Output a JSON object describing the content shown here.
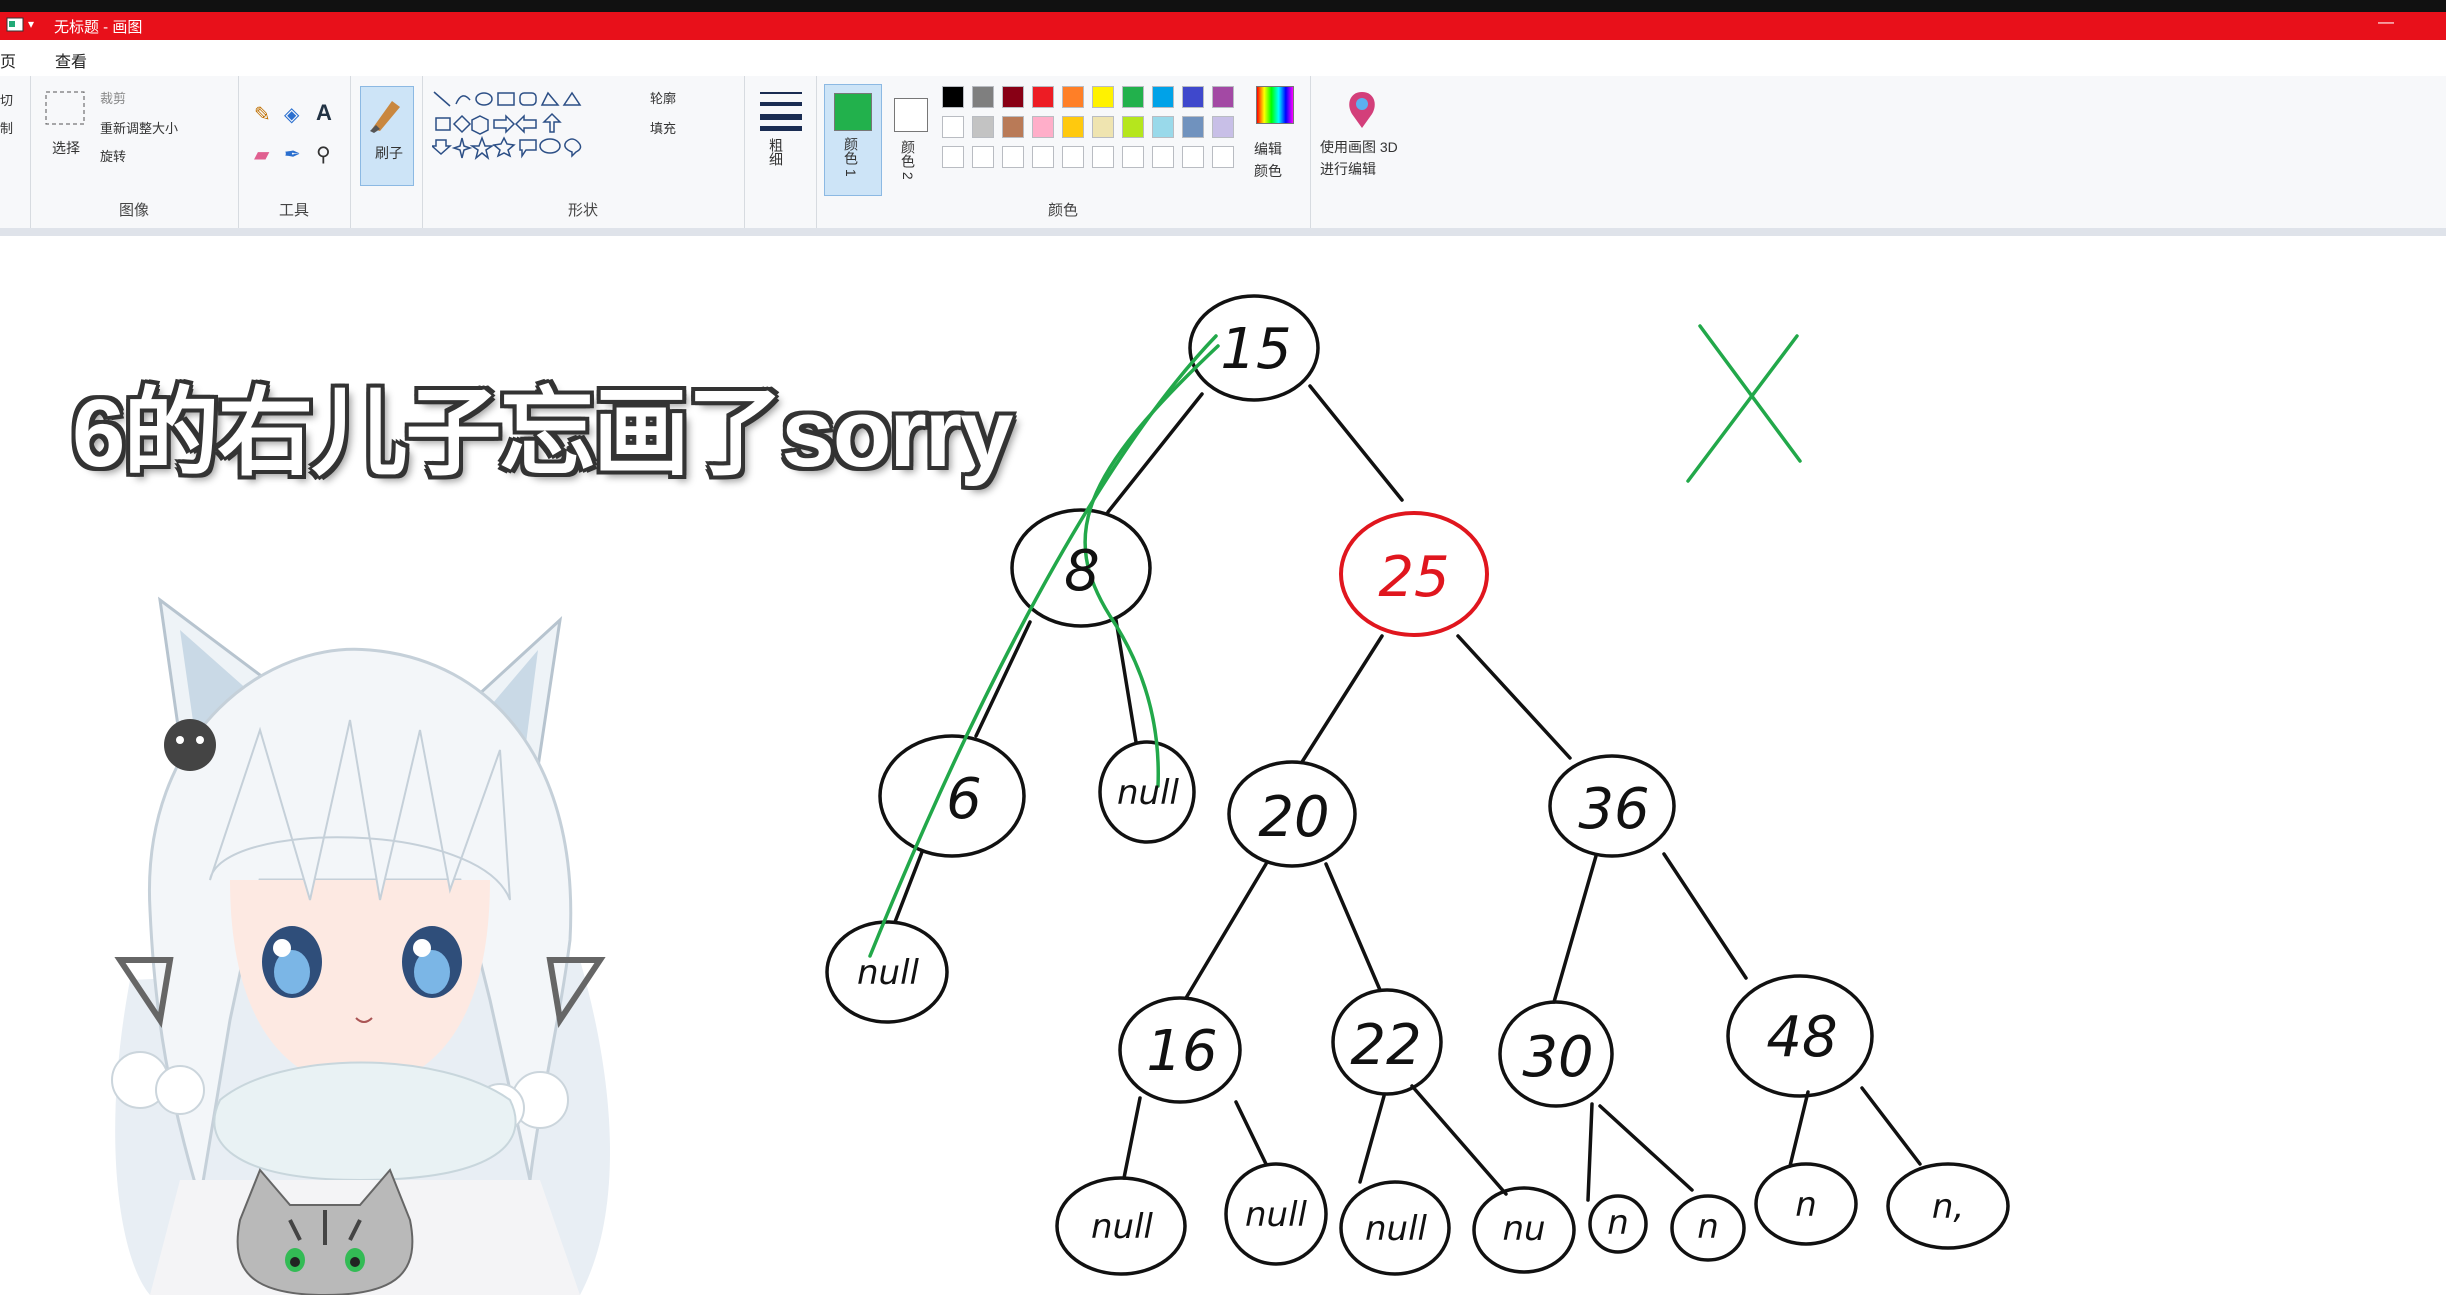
{
  "window": {
    "title": "无标题 - 画图"
  },
  "menu": {
    "home_tab": "页",
    "view_tab": "查看"
  },
  "ribbon": {
    "clip_cut": "切",
    "clip_copy": "制",
    "image_select": "选择",
    "image_crop": "裁剪",
    "image_resize": "重新调整大小",
    "image_rotate": "旋转",
    "image_group": "图像",
    "tools_group": "工具",
    "brush_label": "刷子",
    "shapes_outline": "轮廓",
    "shapes_fill": "填充",
    "shapes_group": "形状",
    "size_label": "粗细",
    "color1_label": "颜色 1",
    "color2_label": "颜色 2",
    "edit_colors": "编辑颜色",
    "colors_group": "颜色",
    "paint3d": "使用画图 3D 进行编辑"
  },
  "palette": {
    "row1": [
      "#000000",
      "#7f7f7f",
      "#880015",
      "#ed1c24",
      "#ff7f27",
      "#fff200",
      "#22b14c",
      "#00a2e8",
      "#3f48cc",
      "#a349a4"
    ],
    "row2": [
      "#ffffff",
      "#c3c3c3",
      "#b97a57",
      "#ffaec9",
      "#ffc90e",
      "#efe4b0",
      "#b5e61d",
      "#99d9ea",
      "#7092be",
      "#c8bfe7"
    ],
    "color1": "#22b14c",
    "color2": "#ffffff"
  },
  "overlay": {
    "caption": "6的右儿子忘画了sorry"
  },
  "tree": {
    "root": "15",
    "n8": "8",
    "n25": "25",
    "n6": "6",
    "n8_right": "null",
    "n20": "20",
    "n36": "36",
    "n6_left": "null",
    "n16": "16",
    "n22": "22",
    "n30": "30",
    "n48": "48",
    "n16_left": "null",
    "n16_right": "null",
    "n22_left": "null",
    "n22_right": "nu",
    "n30_left": "n",
    "n30_right": "n",
    "n48_left": "n",
    "n48_right": "n,",
    "colors": {
      "ink": "#111111",
      "highlight": "#e0161e",
      "green": "#22a84a"
    }
  }
}
